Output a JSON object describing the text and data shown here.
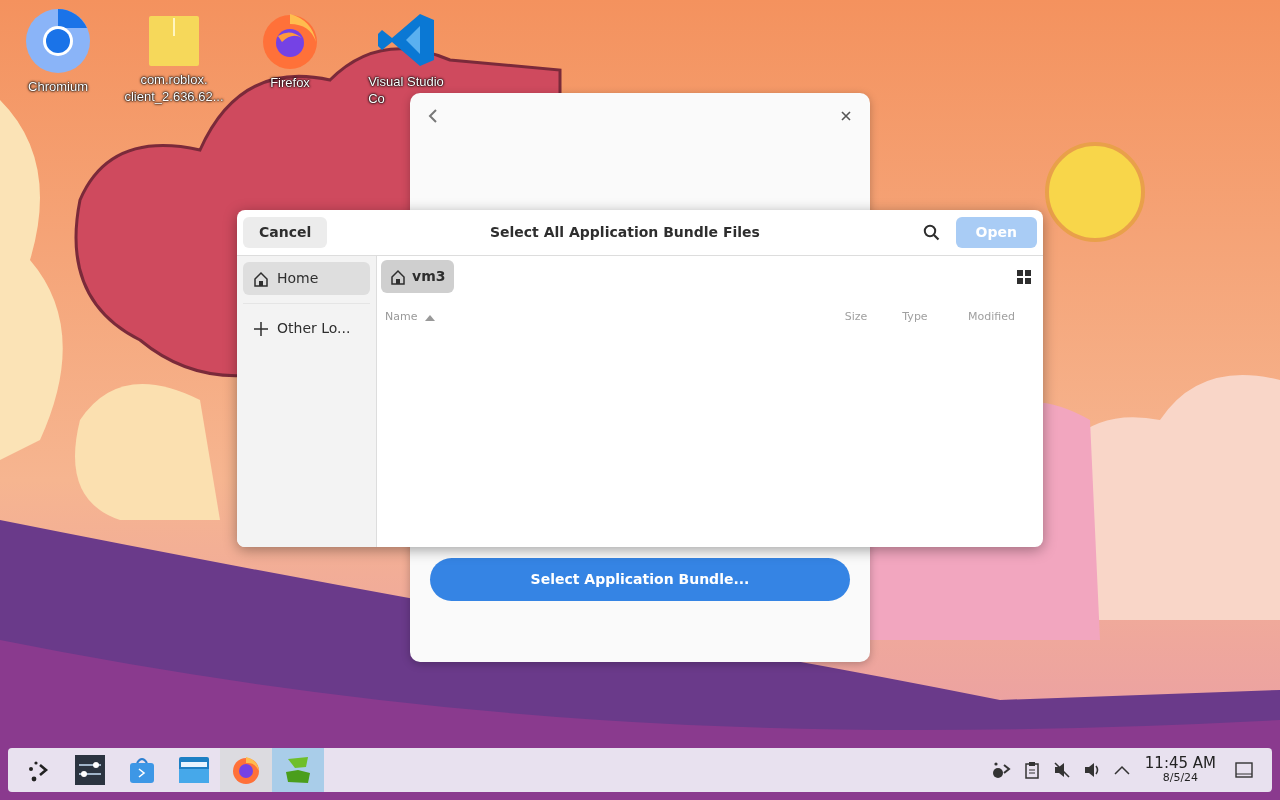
{
  "desktop_icons": [
    {
      "kind": "chromium",
      "label": "Chromium"
    },
    {
      "kind": "file",
      "label": "com.roblox.\nclient_2.636.62..."
    },
    {
      "kind": "firefox",
      "label": "Firefox"
    },
    {
      "kind": "vscode",
      "label": "Visual Studio\nCo"
    }
  ],
  "background_window": {
    "button": "Select Application Bundle..."
  },
  "dialog": {
    "title": "Select All Application Bundle Files",
    "cancel": "Cancel",
    "open": {
      "label": "Open",
      "disabled": true
    },
    "places": [
      {
        "kind": "home",
        "label": "Home",
        "selected": true
      },
      {
        "kind": "other",
        "label": "Other Lo...",
        "selected": false
      }
    ],
    "path": [
      {
        "label": "vm3",
        "selected": true
      }
    ],
    "columns": [
      {
        "label": "Name",
        "sorted": true
      },
      {
        "label": "Size",
        "sorted": false
      },
      {
        "label": "Type",
        "sorted": false
      },
      {
        "label": "Modified",
        "sorted": false
      }
    ]
  },
  "taskbar": {
    "apps": [
      {
        "kind": "launcher",
        "running": false,
        "selected": false
      },
      {
        "kind": "settings",
        "running": false,
        "selected": false
      },
      {
        "kind": "store",
        "running": false,
        "selected": false
      },
      {
        "kind": "files",
        "running": false,
        "selected": false
      },
      {
        "kind": "firefox",
        "running": true,
        "selected": false
      },
      {
        "kind": "app",
        "running": false,
        "selected": true
      }
    ],
    "tray": [
      {
        "kind": "network"
      },
      {
        "kind": "clipboard"
      },
      {
        "kind": "muted"
      },
      {
        "kind": "volume"
      },
      {
        "kind": "expand"
      }
    ],
    "clock": {
      "time": "11:45 AM",
      "date": "8/5/24"
    }
  }
}
